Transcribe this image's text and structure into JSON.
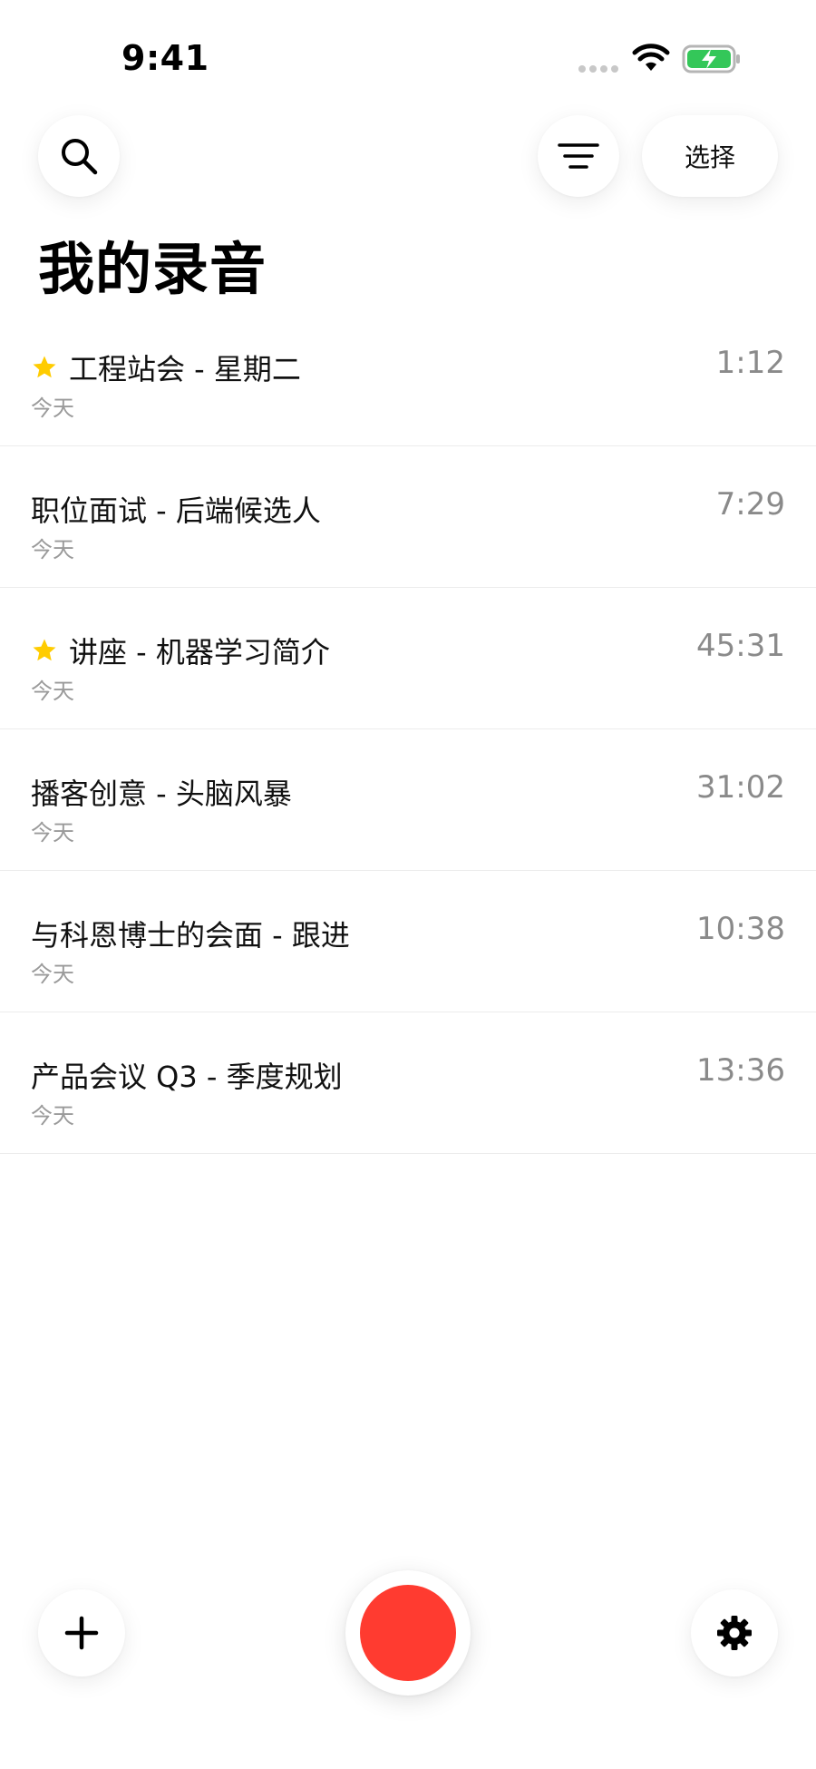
{
  "status_bar": {
    "time": "9:41",
    "icons": [
      "cellular-signal-icon",
      "wifi-icon",
      "battery-charging-icon"
    ],
    "battery_color": "#34c759"
  },
  "header": {
    "search_icon": "search-icon",
    "filter_icon": "filter-icon",
    "select_label": "选择"
  },
  "page_title": "我的录音",
  "recordings": [
    {
      "title": "工程站会 - 星期二",
      "date": "今天",
      "duration": "1:12",
      "starred": true
    },
    {
      "title": "职位面试 - 后端候选人",
      "date": "今天",
      "duration": "7:29",
      "starred": false
    },
    {
      "title": "讲座 - 机器学习简介",
      "date": "今天",
      "duration": "45:31",
      "starred": true
    },
    {
      "title": "播客创意 - 头脑风暴",
      "date": "今天",
      "duration": "31:02",
      "starred": false
    },
    {
      "title": "与科恩博士的会面 - 跟进",
      "date": "今天",
      "duration": "10:38",
      "starred": false
    },
    {
      "title": "产品会议 Q3 - 季度规划",
      "date": "今天",
      "duration": "13:36",
      "starred": false
    }
  ],
  "bottom_bar": {
    "add_icon": "plus-icon",
    "record_icon": "record-icon",
    "settings_icon": "gear-icon"
  },
  "colors": {
    "star": "#ffcc00",
    "record": "#ff3b30"
  }
}
